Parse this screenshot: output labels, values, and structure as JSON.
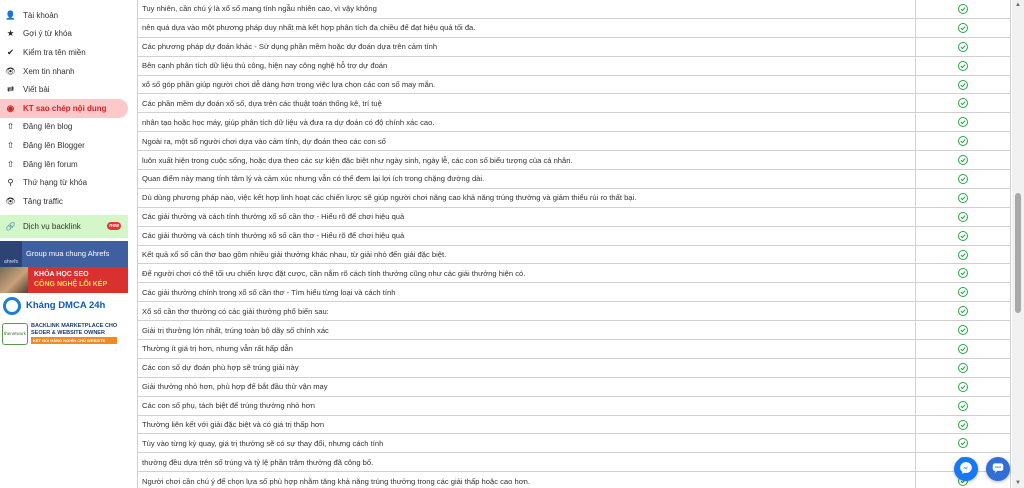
{
  "sidebar": {
    "items": [
      {
        "label": "Tài khoản",
        "icon": "user-icon"
      },
      {
        "label": "Gợi ý từ khóa",
        "icon": "star-icon"
      },
      {
        "label": "Kiểm tra tên miền",
        "icon": "check-icon"
      },
      {
        "label": "Xem tin nhanh",
        "icon": "eye-icon"
      },
      {
        "label": "Viết bài",
        "icon": "shuffle-icon"
      },
      {
        "label": "KT sao chép nội dung",
        "icon": "target-icon",
        "active": true
      },
      {
        "label": "Đăng lên blog",
        "icon": "upload-icon"
      },
      {
        "label": "Đăng lên Blogger",
        "icon": "upload-icon"
      },
      {
        "label": "Đăng lên forum",
        "icon": "upload-icon"
      },
      {
        "label": "Thứ hạng từ khóa",
        "icon": "search-icon"
      },
      {
        "label": "Tăng traffic",
        "icon": "eye-icon"
      }
    ],
    "backlink": {
      "label": "Dịch vụ backlink",
      "badge": "new"
    },
    "banners": {
      "ahrefs": {
        "label": "Group mua chung Ahrefs",
        "logo": "ahrefs"
      },
      "seo": {
        "line1": "KHÓA HỌC SEO",
        "line2": "CÔNG NGHỆ LÕI KÉP"
      },
      "dmca": {
        "label": "Kháng DMCA 24h"
      },
      "market": {
        "line1": "BACKLINK MARKETPLACE CHO",
        "line2": "SEOER & WEBSITE OWNER",
        "line3": "KẾT NỐI HÀNG NGHÌN CHỦ WEBSITE",
        "logo": "thenetwork"
      }
    }
  },
  "table": {
    "rows": [
      "Tuy nhiên, cần chú ý là xổ số mang tính ngẫu nhiên cao, vì vậy không",
      "nên quá dựa vào một phương pháp duy nhất mà kết hợp phân tích đa chiều để đạt hiệu quả tối đa.",
      "Các phương pháp dự đoán khác - Sử dụng phần mềm hoặc dự đoán dựa trên cảm tính",
      "Bên cạnh phân tích dữ liệu thủ công, hiện nay công nghệ hỗ trợ dự đoán",
      "xổ số góp phần giúp người chơi dễ dàng hơn trong việc lựa chọn các con số may mắn.",
      "Các phần mềm dự đoán xổ số, dựa trên các thuật toán thống kê, trí tuệ",
      "nhân tạo hoặc học máy, giúp phân tích dữ liệu và đưa ra dự đoán có độ chính xác cao.",
      "Ngoài ra, một số người chơi dựa vào cảm tính, dự đoán theo các con số",
      "luôn xuất hiện trong cuộc sống, hoặc dựa theo các sự kiện đặc biệt như ngày sinh, ngày lễ, các con số biểu tượng của cá nhân.",
      "Quan điểm này mang tính tâm lý và cảm xúc nhưng vẫn có thể đem lại lợi ích trong chặng đường dài.",
      "Dù dùng phương pháp nào, việc kết hợp linh hoạt các chiến lược sẽ giúp người chơi nâng cao khả năng trúng thưởng và giảm thiểu rủi ro thất bại.",
      "Các giải thưởng và cách tính thưởng xổ số cần thơ - Hiểu rõ để chơi hiệu quả",
      "Các giải thưởng và cách tính thưởng xổ số cần thơ - Hiểu rõ để chơi hiệu quả",
      "Kết quả xổ số cần thơ bao gồm nhiều giải thưởng khác nhau, từ giải nhỏ đến giải đặc biệt.",
      "Để người chơi có thể tối ưu chiến lược đặt cược, cần nắm rõ cách tính thưởng cũng như các giải thưởng hiện có.",
      "Các giải thưởng chính trong xổ số cần thơ - Tìm hiểu từng loại và cách tính",
      "Xổ số cần thơ thường có các giải thưởng phổ biến sau:",
      "Giải trị thưởng lớn nhất, trúng toàn bộ dãy số chính xác",
      "Thường ít giá trị hơn, nhưng vẫn rất hấp dẫn",
      "Các con số dự đoán phù hợp sẽ trúng giải này",
      "Giải thưởng nhỏ hơn, phù hợp để bắt đầu thử vận may",
      "Các con số phụ, tách biệt để trúng thưởng nhỏ hơn",
      "Thường liên kết với giải đặc biệt và có giá trị thấp hơn",
      "Tùy vào từng kỳ quay, giá trị thưởng sẽ có sự thay đổi, nhưng cách tính",
      "thường đều dựa trên số trúng và tỷ lệ phần trăm thưởng đã công bố.",
      "Người chơi cần chú ý để chọn lựa số phù hợp nhằm tăng khả năng trúng thưởng trong các giải thấp hoặc cao hơn."
    ],
    "status_icon": "check-circle-icon"
  },
  "colors": {
    "accent": "#d02424",
    "check": "#28a745",
    "backlink_bg": "#d4f7c9",
    "ahrefs_bg": "#3f5f9e",
    "seo_bg": "#d93030"
  },
  "floating": {
    "messenger_icon": "messenger-icon",
    "chat_icon": "chat-icon"
  }
}
